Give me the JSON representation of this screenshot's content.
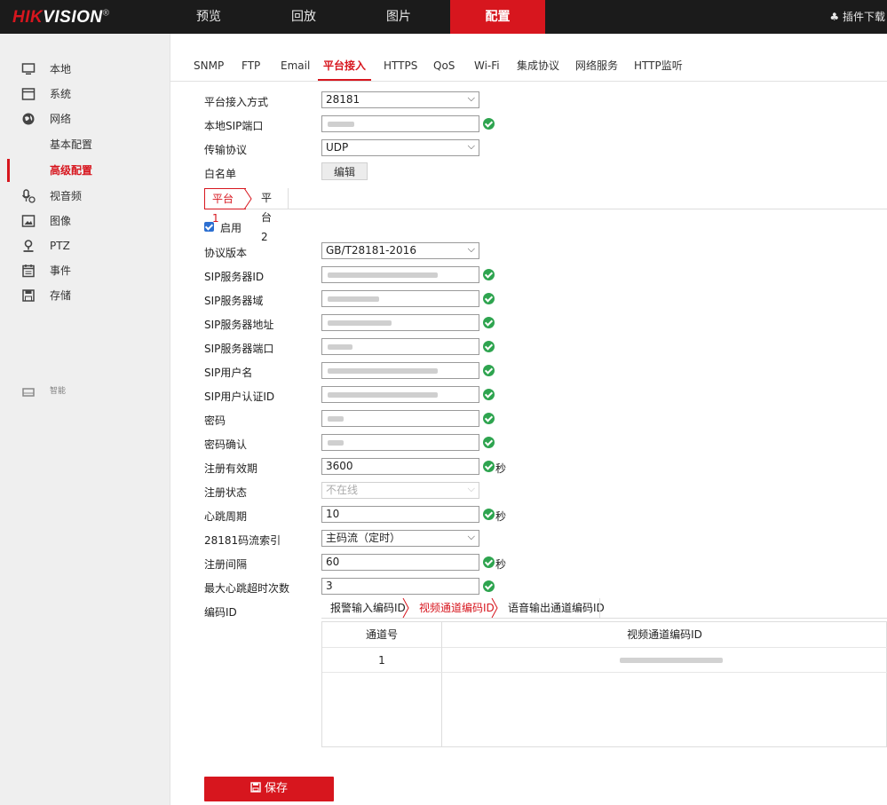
{
  "brand": {
    "name_red": "HIK",
    "name_white": "VISION",
    "mark": "®"
  },
  "topnav": [
    {
      "label": "预览"
    },
    {
      "label": "回放"
    },
    {
      "label": "图片"
    },
    {
      "label": "配置"
    }
  ],
  "plugin_download": "插件下载",
  "sidebar": {
    "items": [
      {
        "label": "本地",
        "icon": "monitor-icon"
      },
      {
        "label": "系统",
        "icon": "system-icon"
      },
      {
        "label": "网络",
        "icon": "globe-icon"
      },
      {
        "label": "基本配置"
      },
      {
        "label": "高级配置"
      },
      {
        "label": "视音频",
        "icon": "mic-icon"
      },
      {
        "label": "图像",
        "icon": "image-icon"
      },
      {
        "label": "PTZ",
        "icon": "ptz-icon"
      },
      {
        "label": "事件",
        "icon": "event-icon"
      },
      {
        "label": "存储",
        "icon": "storage-icon"
      },
      {
        "label": "智能",
        "icon": "smart-icon"
      }
    ]
  },
  "tabs": [
    "SNMP",
    "FTP",
    "Email",
    "平台接入",
    "HTTPS",
    "QoS",
    "Wi-Fi",
    "集成协议",
    "网络服务",
    "HTTP监听"
  ],
  "form_top": {
    "access_mode_label": "平台接入方式",
    "access_mode_value": "28181",
    "sip_port_label": "本地SIP端口",
    "transport_label": "传输协议",
    "transport_value": "UDP",
    "whitelist_label": "白名单",
    "edit_label": "编辑"
  },
  "platform_tabs": [
    "平台1",
    "平台2"
  ],
  "form": {
    "enable_label": "启用",
    "protocol_label": "协议版本",
    "protocol_value": "GB/T28181-2016",
    "sip_server_id_label": "SIP服务器ID",
    "sip_server_domain_label": "SIP服务器域",
    "sip_server_addr_label": "SIP服务器地址",
    "sip_server_port_label": "SIP服务器端口",
    "sip_user_label": "SIP用户名",
    "sip_auth_label": "SIP用户认证ID",
    "password_label": "密码",
    "password_confirm_label": "密码确认",
    "reg_valid_label": "注册有效期",
    "reg_valid_value": "3600",
    "reg_status_label": "注册状态",
    "reg_status_value": "不在线",
    "heartbeat_label": "心跳周期",
    "heartbeat_value": "10",
    "stream_index_label": "28181码流索引",
    "stream_index_value": "主码流（定时）",
    "reg_interval_label": "注册间隔",
    "reg_interval_value": "60",
    "max_timeout_label": "最大心跳超时次数",
    "max_timeout_value": "3",
    "encode_id_label": "编码ID",
    "unit_sec": "秒"
  },
  "encode_tabs": [
    "报警输入编码ID",
    "视频通道编码ID",
    "语音输出通道编码ID"
  ],
  "table": {
    "headers": [
      "通道号",
      "视频通道编码ID"
    ],
    "rows": [
      {
        "channel": "1"
      }
    ]
  },
  "save_label": "保存"
}
